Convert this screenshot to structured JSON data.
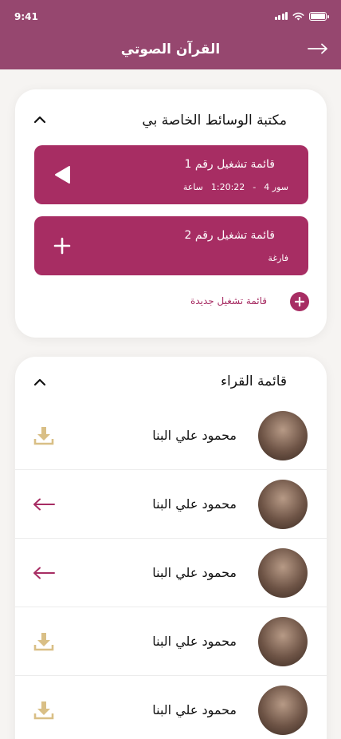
{
  "status_bar": {
    "time": "9:41"
  },
  "header": {
    "title": "القرآن الصوتي"
  },
  "media_library": {
    "title": "مكتبة الوسائط الخاصة بي",
    "playlists": [
      {
        "title": "قائمة تشغيل رقم 1",
        "surahs": "سور 4",
        "separator": "-",
        "duration": "1:20:22",
        "unit": "ساعة",
        "action": "play"
      },
      {
        "title": "قائمة تشغيل رقم 2",
        "status": "فارغة",
        "action": "add"
      }
    ],
    "new_playlist_label": "قائمة تشغيل جديدة"
  },
  "readers": {
    "title": "قائمة القراء",
    "items": [
      {
        "name": "محمود علي البنا",
        "action_icon": "download-icon"
      },
      {
        "name": "محمود علي البنا",
        "action_icon": "arrow-left-icon"
      },
      {
        "name": "محمود علي البنا",
        "action_icon": "arrow-left-icon"
      },
      {
        "name": "محمود علي البنا",
        "action_icon": "download-icon"
      },
      {
        "name": "محمود علي البنا",
        "action_icon": "download-icon"
      }
    ]
  },
  "colors": {
    "header": "#96476f",
    "accent": "#a72d63",
    "download": "#d9bf86"
  }
}
